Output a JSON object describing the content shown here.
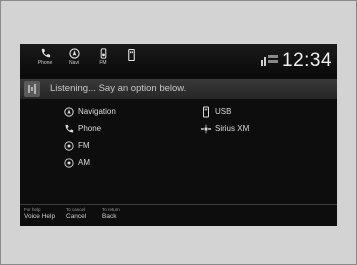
{
  "status_bar": {
    "buttons": [
      {
        "icon": "phone-icon",
        "label": "Phone"
      },
      {
        "icon": "navigation-icon",
        "label": "Navi"
      },
      {
        "icon": "audio-icon",
        "label": "FM"
      },
      {
        "icon": "usb-icon",
        "label": ""
      }
    ],
    "clock": "12:34"
  },
  "prompt": {
    "icon": "voice-icon",
    "text": "Listening... Say an option below."
  },
  "options": [
    {
      "icon": "navigation-icon",
      "label": "Navigation"
    },
    {
      "icon": "phone-icon",
      "label": "Phone"
    },
    {
      "icon": "radio-icon",
      "label": "FM"
    },
    {
      "icon": "radio-icon",
      "label": "AM"
    },
    {
      "icon": "usb-icon",
      "label": "USB"
    },
    {
      "icon": "satellite-icon",
      "label": "Sirius XM"
    }
  ],
  "footer": {
    "hints": [
      {
        "small": "For help",
        "big": "Voice Help"
      },
      {
        "small": "To cancel",
        "big": "Cancel"
      },
      {
        "small": "To return",
        "big": "Back"
      }
    ]
  }
}
